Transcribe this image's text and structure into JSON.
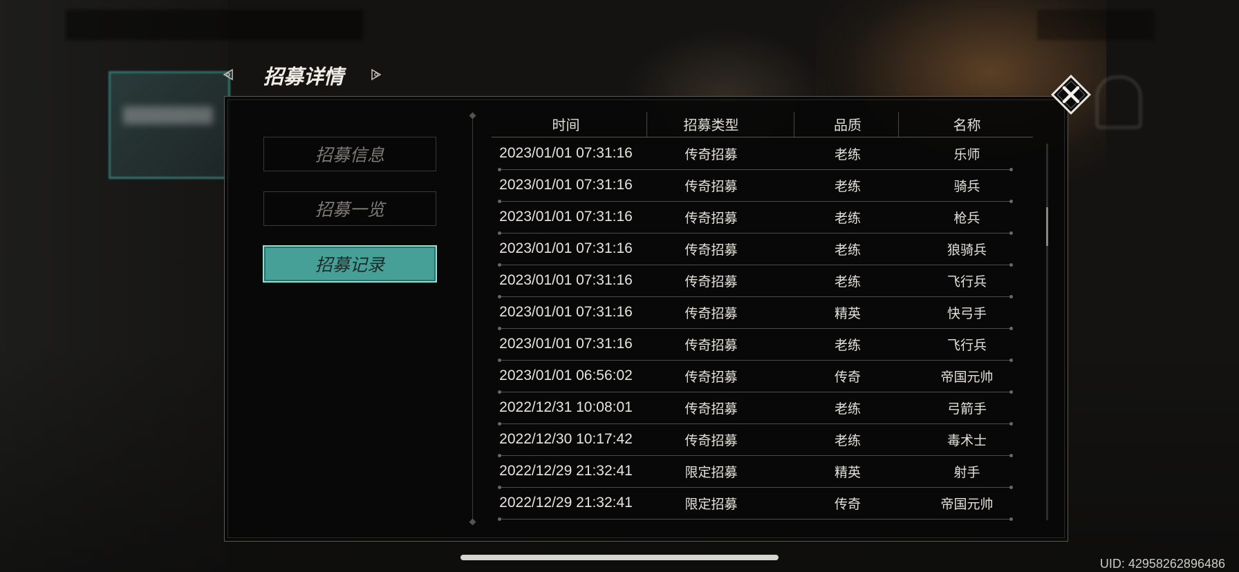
{
  "header": {
    "title": "招募详情"
  },
  "menu": {
    "items": [
      {
        "label": "招募信息",
        "active": false
      },
      {
        "label": "招募一览",
        "active": false
      },
      {
        "label": "招募记录",
        "active": true
      }
    ]
  },
  "table": {
    "columns": [
      "时间",
      "招募类型",
      "品质",
      "名称"
    ],
    "rows": [
      {
        "time": "2023/01/01 07:31:16",
        "type": "传奇招募",
        "quality": "老练",
        "name": "乐师"
      },
      {
        "time": "2023/01/01 07:31:16",
        "type": "传奇招募",
        "quality": "老练",
        "name": "骑兵"
      },
      {
        "time": "2023/01/01 07:31:16",
        "type": "传奇招募",
        "quality": "老练",
        "name": "枪兵"
      },
      {
        "time": "2023/01/01 07:31:16",
        "type": "传奇招募",
        "quality": "老练",
        "name": "狼骑兵"
      },
      {
        "time": "2023/01/01 07:31:16",
        "type": "传奇招募",
        "quality": "老练",
        "name": "飞行兵"
      },
      {
        "time": "2023/01/01 07:31:16",
        "type": "传奇招募",
        "quality": "精英",
        "name": "快弓手"
      },
      {
        "time": "2023/01/01 07:31:16",
        "type": "传奇招募",
        "quality": "老练",
        "name": "飞行兵"
      },
      {
        "time": "2023/01/01 06:56:02",
        "type": "传奇招募",
        "quality": "传奇",
        "name": "帝国元帅"
      },
      {
        "time": "2022/12/31 10:08:01",
        "type": "传奇招募",
        "quality": "老练",
        "name": "弓箭手"
      },
      {
        "time": "2022/12/30 10:17:42",
        "type": "传奇招募",
        "quality": "老练",
        "name": "毒术士"
      },
      {
        "time": "2022/12/29 21:32:41",
        "type": "限定招募",
        "quality": "精英",
        "name": "射手"
      },
      {
        "time": "2022/12/29 21:32:41",
        "type": "限定招募",
        "quality": "传奇",
        "name": "帝国元帅"
      }
    ]
  },
  "footer": {
    "uid": "UID: 42958262896486"
  },
  "colors": {
    "accent": "#47a097",
    "accent_border": "#8fe0d6",
    "panel": "#070707"
  },
  "icons": {
    "close": "close-icon",
    "prev": "arrow-left-icon",
    "next": "arrow-right-icon"
  }
}
